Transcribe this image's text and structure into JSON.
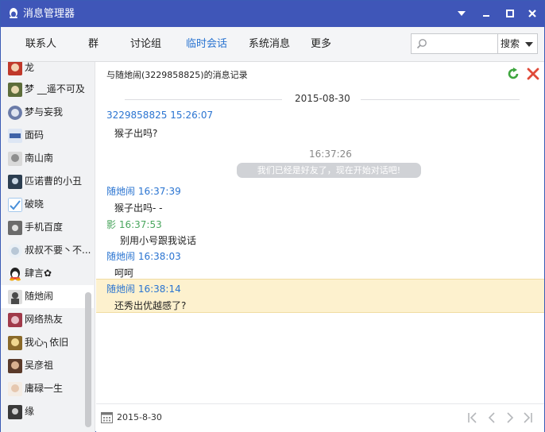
{
  "window": {
    "title": "消息管理器"
  },
  "nav": {
    "tabs": [
      "联系人",
      "群",
      "讨论组",
      "临时会话",
      "系统消息",
      "更多"
    ],
    "active_tab": "临时会话",
    "search": {
      "placeholder": "",
      "button_label": "搜索"
    }
  },
  "contacts": [
    {
      "name": "龙",
      "avatar_color": "#c0392b"
    },
    {
      "name": "梦 __遥不可及",
      "avatar_color": "#5d6d3a"
    },
    {
      "name": "梦与妄我",
      "avatar_color": "#6a7ba8"
    },
    {
      "name": "面码",
      "avatar_color": "#3f63a8"
    },
    {
      "name": "南山南",
      "avatar_color": "#8e8e8e"
    },
    {
      "name": "匹诺曹的小丑",
      "avatar_color": "#2c3e50"
    },
    {
      "name": "破晓",
      "avatar_color": "#4a90d9"
    },
    {
      "name": "手机百度",
      "avatar_color": "#6b6b6b"
    },
    {
      "name": "叔叔不要丶不...",
      "avatar_color": "#b8c7d6"
    },
    {
      "name": "肆言✿",
      "avatar_color": "#f0a500"
    },
    {
      "name": "随灺闹",
      "avatar_color": "#4a4a4a"
    },
    {
      "name": "网络热友",
      "avatar_color": "#a03a4a"
    },
    {
      "name": "我心╮依旧",
      "avatar_color": "#8a6a2a"
    },
    {
      "name": "吴彦祖",
      "avatar_color": "#5a3a2a"
    },
    {
      "name": "庸碌一生",
      "avatar_color": "#e6c8b0"
    },
    {
      "name": "缘",
      "avatar_color": "#3a3a3a"
    }
  ],
  "active_contact": "随灺闹",
  "record": {
    "title": "与随灺闹(3229858825)的消息记录",
    "date": "2015-08-30",
    "messages": [
      {
        "sender": "3229858825",
        "time": "15:26:07",
        "text": "猴子出吗?"
      },
      {
        "sender": "随灺闹",
        "time": "16:37:39",
        "text": "猴子出吗- -"
      },
      {
        "sender": "影",
        "time": "16:37:53",
        "text": "别用小号跟我说话"
      },
      {
        "sender": "随灺闹",
        "time": "16:38:03",
        "text": "呵呵"
      },
      {
        "sender": "随灺闹",
        "time": "16:38:14",
        "text": "还秀出优越感了?"
      }
    ],
    "system_notice": {
      "time": "16:37:26",
      "text": "我们已经是好友了，现在开始对话吧!"
    }
  },
  "footer": {
    "date": "2015-8-30"
  },
  "colors": {
    "titlebar": "#3f56b8",
    "accent": "#2a74d1",
    "self_name": "#4aa65e",
    "highlight": "#fdf1ce"
  }
}
